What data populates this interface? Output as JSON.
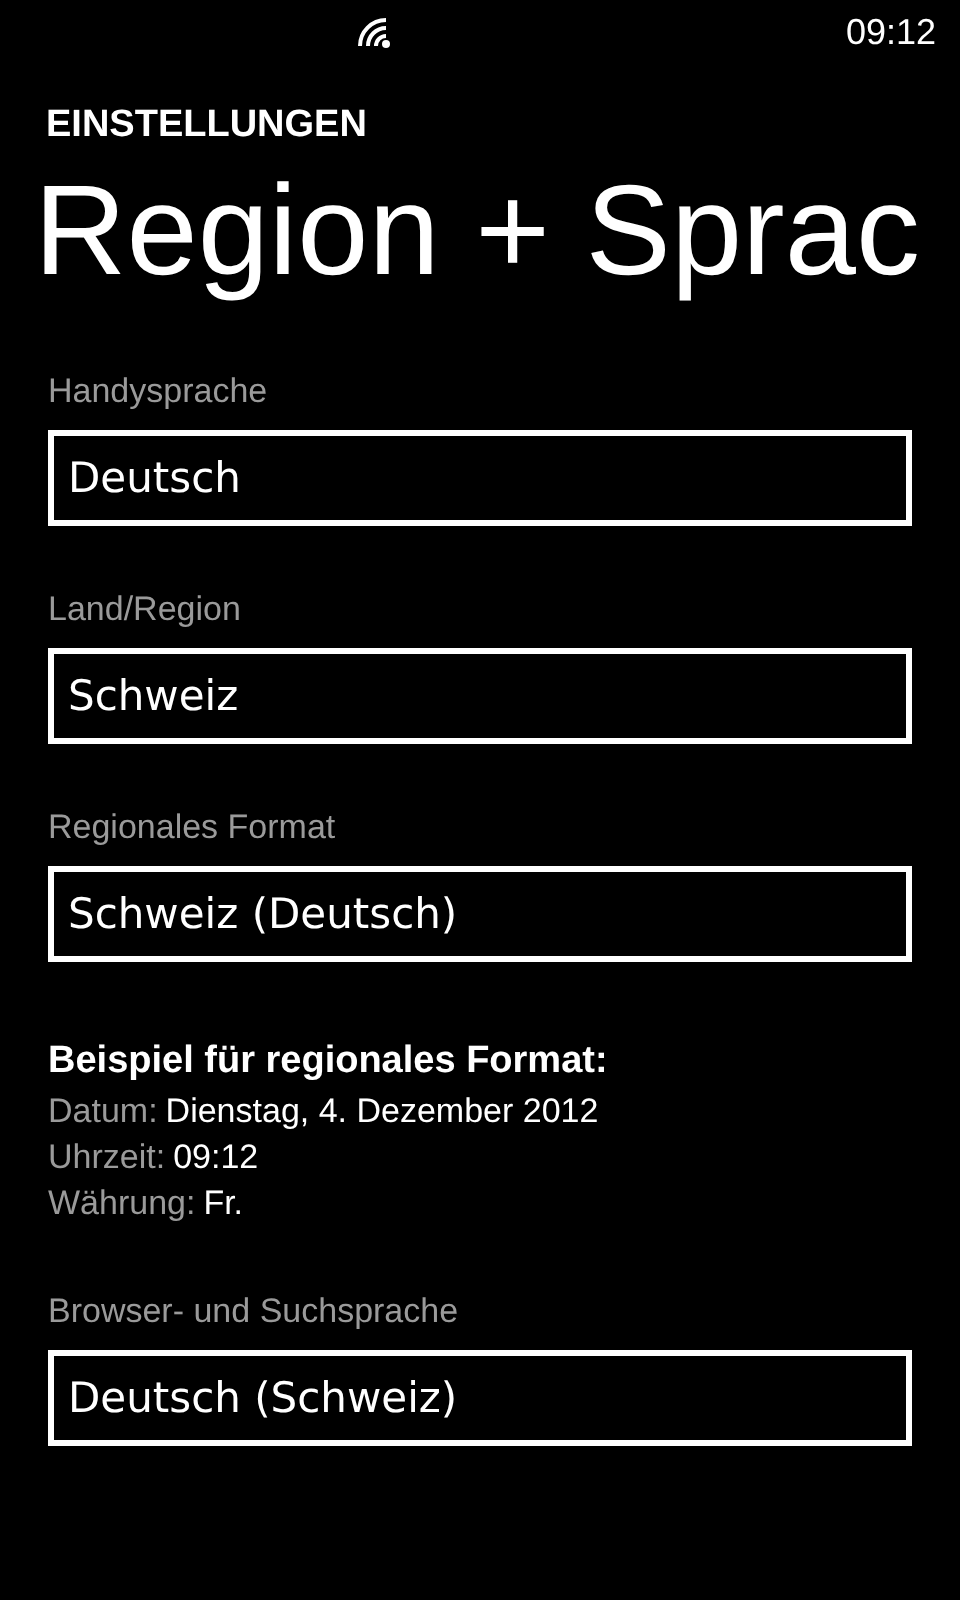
{
  "status_bar": {
    "time": "09:12"
  },
  "header": {
    "app": "EINSTELLUNGEN",
    "title": "Region + Sprac"
  },
  "fields": [
    {
      "label": "Handysprache",
      "value": "Deutsch"
    },
    {
      "label": "Land/Region",
      "value": "Schweiz"
    },
    {
      "label": "Regionales Format",
      "value": "Schweiz (Deutsch)"
    }
  ],
  "example": {
    "title": "Beispiel für regionales Format:",
    "rows": [
      {
        "label": "Datum:",
        "value": "Dienstag, 4. Dezember 2012"
      },
      {
        "label": "Uhrzeit:",
        "value": "09:12"
      },
      {
        "label": "Währung:",
        "value": "Fr."
      }
    ]
  },
  "browser_field": {
    "label": "Browser- und Suchsprache",
    "value": "Deutsch (Schweiz)"
  }
}
